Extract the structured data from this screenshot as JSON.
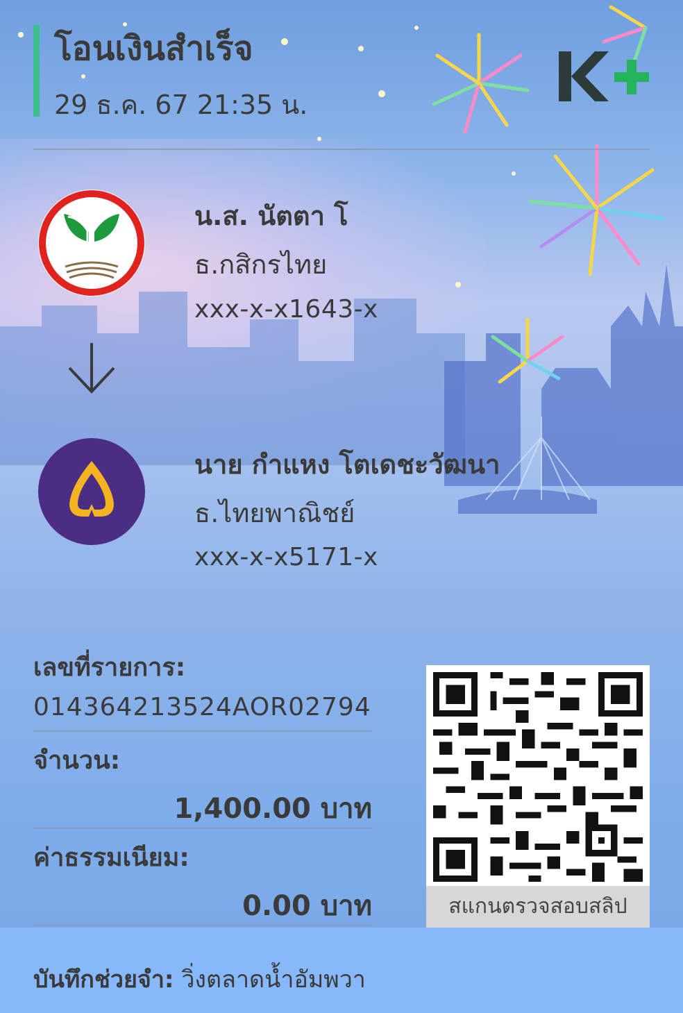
{
  "header": {
    "title": "โอนเงินสำเร็จ",
    "datetime": "29 ธ.ค. 67  21:35 น."
  },
  "brand": {
    "logo_icon": "kplus-logo-icon",
    "accent": "#3cc08a"
  },
  "sender": {
    "name": "น.ส. นัตตา โ",
    "bank": "ธ.กสิกรไทย",
    "account": "xxx-x-x1643-x",
    "logo_icon": "kasikorn-bank-icon"
  },
  "transfer_arrow_icon": "arrow-down-icon",
  "receiver": {
    "name": "นาย กำแหง โตเดชะวัฒนา",
    "bank": "ธ.ไทยพาณิชย์",
    "account": "xxx-x-x5171-x",
    "logo_icon": "scb-bank-icon"
  },
  "details": {
    "transaction_label": "เลขที่รายการ:",
    "transaction_id": "014364213524AOR02794",
    "amount_label": "จำนวน:",
    "amount": "1,400.00 บาท",
    "fee_label": "ค่าธรรมเนียม:",
    "fee": "0.00 บาท"
  },
  "qr": {
    "caption": "สแกนตรวจสอบสลิป"
  },
  "memo": {
    "label": "บันทึกช่วยจำ:",
    "value": "วิ่งตลาดน้ำอัมพวา"
  }
}
